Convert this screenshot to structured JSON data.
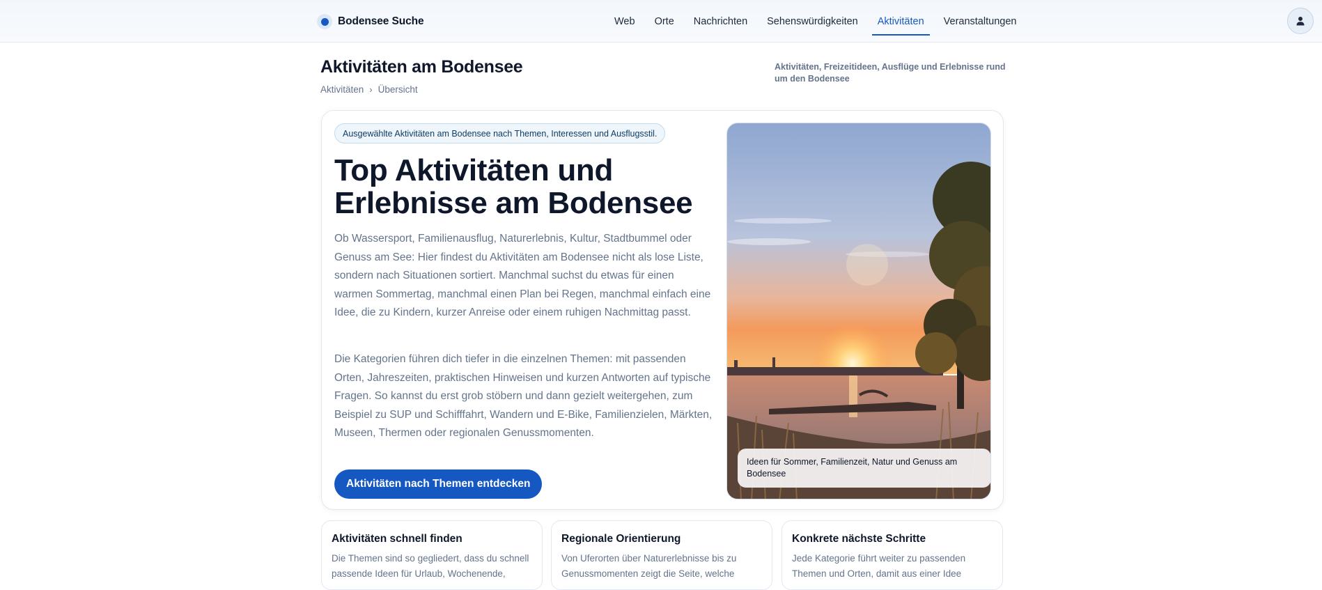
{
  "topbar": {
    "brand": "Bodensee Suche",
    "nav": [
      "Web",
      "Orte",
      "Nachrichten",
      "Sehenswürdigkeiten",
      "Aktivitäten",
      "Veranstaltungen"
    ],
    "active_nav": "Aktivitäten",
    "account_icon": "user-icon"
  },
  "header": {
    "title": "Aktivitäten am Bodensee",
    "breadcrumb": [
      "Aktivitäten",
      "Übersicht"
    ],
    "description": "Aktivitäten, Freizeitideen, Ausflüge und Erlebnisse rund um den Bodensee"
  },
  "hero": {
    "pill": "Ausgewählte Aktivitäten am Bodensee nach Themen, Interessen und Ausflugsstil.",
    "heading": "Top Aktivitäten und Erlebnisse am Bodensee",
    "paragraph_1": "Ob Wassersport, Familienausflug, Naturerlebnis, Kultur, Stadtbummel oder Genuss am See: Hier findest du Aktivitäten am Bodensee nicht als lose Liste, sondern nach Situationen sortiert. Manchmal suchst du etwas für einen warmen Sommertag, manchmal einen Plan bei Regen, manchmal einfach eine Idee, die zu Kindern, kurzer Anreise oder einem ruhigen Nachmittag passt.",
    "paragraph_2": "Die Kategorien führen dich tiefer in die einzelnen Themen: mit passenden Orten, Jahreszeiten, praktischen Hinweisen und kurzen Antworten auf typische Fragen. So kannst du erst grob stöbern und dann gezielt weitergehen, zum Beispiel zu SUP und Schifffahrt, Wandern und E-Bike, Familienzielen, Märkten, Museen, Thermen oder regionalen Genussmomenten.",
    "cta_label": "Aktivitäten nach Themen entdecken",
    "image_caption": "Ideen für Sommer, Familienzeit, Natur und Genuss am Bodensee"
  },
  "features": [
    {
      "title": "Aktivitäten schnell finden",
      "text": "Die Themen sind so gegliedert, dass du schnell passende Ideen für Urlaub, Wochenende,"
    },
    {
      "title": "Regionale Orientierung",
      "text": "Von Uferorten über Naturerlebnisse bis zu Genussmomenten zeigt die Seite, welche"
    },
    {
      "title": "Konkrete nächste Schritte",
      "text": "Jede Kategorie führt weiter zu passenden Themen und Orten, damit aus einer Idee"
    }
  ],
  "colors": {
    "accent": "#1558c2",
    "heading": "#0f172a",
    "muted_text": "#64748b",
    "border": "#e2e8f0"
  }
}
